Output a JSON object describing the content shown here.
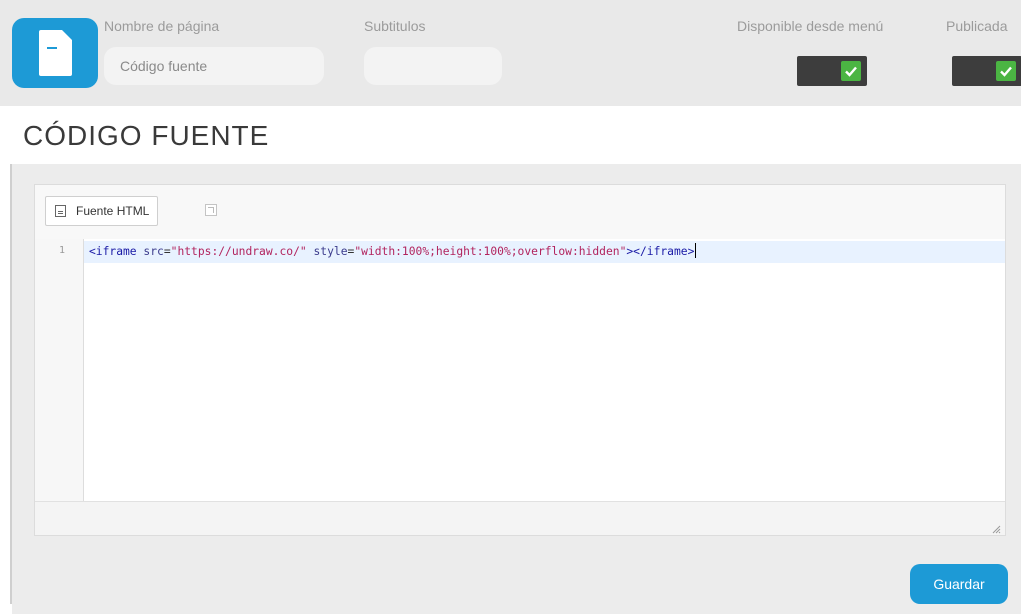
{
  "header": {
    "page_name_label": "Nombre de página",
    "page_name_value": "Código fuente",
    "subtitles_label": "Subtitulos",
    "subtitles_value": "",
    "menu_available_label": "Disponible desde menú",
    "menu_available_checked": true,
    "published_label": "Publicada",
    "published_checked": true
  },
  "title": "CÓDIGO FUENTE",
  "editor": {
    "source_button_label": "Fuente HTML",
    "line_number": "1",
    "code": {
      "open_tag": "<iframe",
      "src_attr": "src",
      "src_value": "\"https://undraw.co/\"",
      "style_attr": "style",
      "style_value": "\"width:100%;height:100%;overflow:hidden\"",
      "close": "></iframe>"
    }
  },
  "actions": {
    "save_label": "Guardar"
  },
  "colors": {
    "accent": "#1d9ad6",
    "toggle_bg": "#3d3d3d",
    "check": "#4bb543"
  }
}
